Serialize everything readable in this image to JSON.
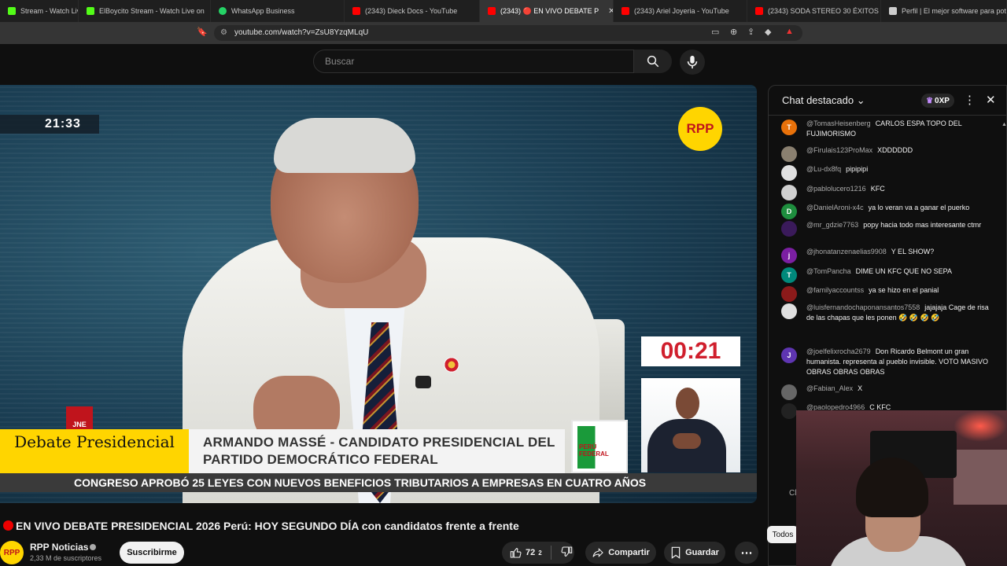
{
  "browser": {
    "tabs": [
      {
        "label": "Stream - Watch Live on K",
        "color": "#53fc18"
      },
      {
        "label": "ElBoycito Stream - Watch Live on",
        "color": "#53fc18"
      },
      {
        "label": "WhatsApp Business",
        "color": "#25d366"
      },
      {
        "label": "(2343) Dieck Docs - YouTube",
        "color": "#ff0000"
      },
      {
        "label": "(2343) 🔴 EN VIVO DEBATE P",
        "color": "#ff0000",
        "close": "✕"
      },
      {
        "label": "(2343) Ariel Joyeria - YouTube",
        "color": "#ff0000"
      },
      {
        "label": "(2343) SODA STEREO 30 ÉXITOS CLÁ",
        "color": "#ff0000"
      },
      {
        "label": "Perfil | El mejor software para poten",
        "color": "#cccccc"
      }
    ],
    "url": "youtube.com/watch?v=ZsU8YzqMLqU"
  },
  "header": {
    "search_placeholder": "Buscar"
  },
  "video": {
    "clock": "21:33",
    "logo": "RPP",
    "countdown": "00:21",
    "jne": "JNE",
    "lower_third_left": "Debate Presidencial",
    "lower_third_right": "ARMANDO MASSÉ - CANDIDATO PRESIDENCIAL DEL PARTIDO DEMOCRÁTICO FEDERAL",
    "flag_label": "PERÚ FEDERAL",
    "ticker": "CONGRESO APROBÓ 25 LEYES CON NUEVOS BENEFICIOS TRIBUTARIOS A EMPRESAS EN CUATRO AÑOS"
  },
  "meta": {
    "title": "EN VIVO DEBATE PRESIDENCIAL 2026 Perú: HOY SEGUNDO DÍA con candidatos frente a frente",
    "channel": "RPP Noticias",
    "avatar": "RPP",
    "subscribers": "2,33 M de suscriptores",
    "subscribe": "Suscribirme",
    "likes": "72",
    "likes_extra": "2",
    "share": "Compartir",
    "save": "Guardar"
  },
  "chat": {
    "title": "Chat destacado",
    "xp": "0XP",
    "messages": [
      {
        "author": "@TomasHeisenberg",
        "text": "CARLOS ESPA TOPO DEL FUJIMORISMO",
        "initial": "T",
        "color": "#e8710a"
      },
      {
        "author": "@Firulais123ProMax",
        "text": "XDDDDDD",
        "initial": "",
        "color": "#8a8070"
      },
      {
        "author": "@Lu-dx8fq",
        "text": "pipipipi",
        "initial": "",
        "color": "#e0e0e0"
      },
      {
        "author": "@pablolucero1216",
        "text": "KFC",
        "initial": "",
        "color": "#d0d0d0"
      },
      {
        "author": "@DanielAroni-x4c",
        "text": "ya lo veran va a ganar el puerko",
        "initial": "D",
        "color": "#1e8e3e"
      },
      {
        "author": "@mr_gdzie7763",
        "text": "popy hacia todo mas interesante ctmr",
        "initial": "",
        "color": "#3a1a5a"
      },
      {
        "author": "@jhonatanzenaelias9908",
        "text": "Y EL SHOW?",
        "initial": "j",
        "color": "#7b1fa2"
      },
      {
        "author": "@TomPancha",
        "text": "DIME UN KFC QUE NO SEPA",
        "initial": "T",
        "color": "#00897b"
      },
      {
        "author": "@familyaccountss",
        "text": "ya se hizo en el panial",
        "initial": "",
        "color": "#8b1a1a"
      },
      {
        "author": "@luisfernandochaponansantos7558",
        "text": "jajajaja Cage de risa de las chapas que les ponen 🤣 🤣 🤣 🤣",
        "initial": "",
        "color": "#e0e0e0"
      },
      {
        "author": "@joelfelixrocha2679",
        "text": "Don Ricardo Belmont un gran humanista. representa al pueblo invisible. VOTO MASIVO OBRAS OBRAS OBRAS",
        "initial": "J",
        "color": "#5e35b1"
      },
      {
        "author": "@Fabian_Alex",
        "text": "X",
        "initial": "",
        "color": "#666666"
      },
      {
        "author": "@paolopedro4966",
        "text": "C KFC",
        "initial": "",
        "color": "#222222"
      }
    ],
    "filter": "Todos",
    "input_hint": "Cl"
  }
}
